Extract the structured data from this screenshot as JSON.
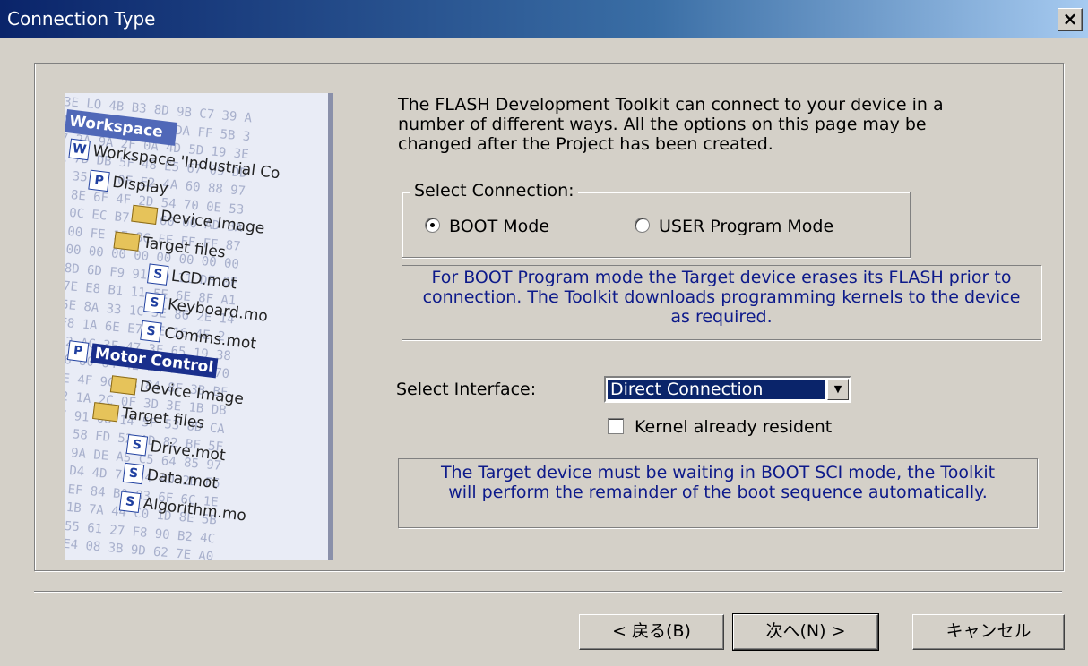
{
  "window": {
    "title": "Connection Type",
    "close_label": "×"
  },
  "illustration": {
    "workspace_label": "Workspace",
    "hex_rows": [
      "3E LO 4B B3 8D 9B C7 39 A",
      "A5 0E 23 D1 48 DA FF 5B 3",
      "7 2A 9A 2F 0A 4D 5D 19 3E",
      "A 7D DB 5F 48 E5 67 09 DD",
      "A 35 8D 0F E2 4A 60 88 97",
      "7 8E 6F 4F 2D 54 70 0E 53",
      "B 0C EC B7 8B 60 00 AD BA",
      "0 00 FE 1F 8C FF FF FF 87",
      "0 00 00 00 00 00 00 00 00",
      "0 8D 6D F9 91 5D 11 DF 0F",
      "A 7E E8 B1 11 5E 6E 8F A1",
      "1 5E 8A 33 1C 5E 86 2E 14",
      "E F8 1A 6E E7 FE 16 4E 2",
      "0 E2 AC 3F 47 3E 65 19 38",
      "F E6 80 64 4E 9A 71 5C 70",
      "3 8E 4F 9C 0B 84 8F 3B BF",
      "B 92 1A 2C 0F 3D 3E 1B DB",
      "8 27 91 08 14 5F 53 8D CA",
      "6 F0 58 FD 52 AD 82 BF 5F",
      "E 5D 9A DE A5 C5 64 85 97",
      "8 24 D4 4D 75 54 AD 2D F6",
      "8 4F EF 84 B0 83 6F 6C 1E",
      "3 9E 1B 7A 44 C0 1D 8E 5B",
      "A 3D 55 61 27 F8 90 B2 4C",
      "6 1A E4 08 3B 9D 62 7E A0"
    ],
    "tree": [
      {
        "label": "Workspace 'Industrial Co",
        "icon": "workspace-icon"
      },
      {
        "label": "Display",
        "icon": "project-icon"
      },
      {
        "label": "Device Image",
        "icon": "folder-icon"
      },
      {
        "label": "Target files",
        "icon": "folder-icon"
      },
      {
        "label": "LCD.mot",
        "icon": "file-icon"
      },
      {
        "label": "Keyboard.mo",
        "icon": "file-icon"
      },
      {
        "label": "Comms.mot",
        "icon": "file-icon"
      },
      {
        "label": "Motor Control",
        "icon": "project-icon"
      },
      {
        "label": "Device Image",
        "icon": "folder-icon"
      },
      {
        "label": "Target files",
        "icon": "folder-icon"
      },
      {
        "label": "Drive.mot",
        "icon": "file-icon"
      },
      {
        "label": "Data.mot",
        "icon": "file-icon"
      },
      {
        "label": "Algorithm.mo",
        "icon": "file-icon"
      }
    ]
  },
  "intro_lines": [
    "The FLASH Development Toolkit can connect to your device in a",
    "number of different ways. All the options on this page may be",
    "changed after the Project has been created."
  ],
  "connection": {
    "group_label": "Select Connection:",
    "options": [
      {
        "label": "BOOT Mode",
        "selected": true
      },
      {
        "label": "USER Program Mode",
        "selected": false
      }
    ],
    "info_lines": [
      "For BOOT Program mode the Target device erases its FLASH prior to",
      "connection. The Toolkit downloads programming kernels to the device",
      "as required."
    ]
  },
  "interface": {
    "label": "Select Interface:",
    "value": "Direct Connection",
    "kernel_label": "Kernel already resident",
    "kernel_checked": false,
    "info_lines": [
      "The Target device must be waiting in BOOT SCI mode, the Toolkit",
      "will perform the remainder of the boot sequence automatically."
    ]
  },
  "buttons": {
    "back": "< 戻る(B)",
    "next": "次へ(N) >",
    "cancel": "キャンセル"
  },
  "colors": {
    "info_text": "#0d1a8a",
    "title_bar": "#0a246a",
    "dialog_face": "#d4d0c8"
  }
}
